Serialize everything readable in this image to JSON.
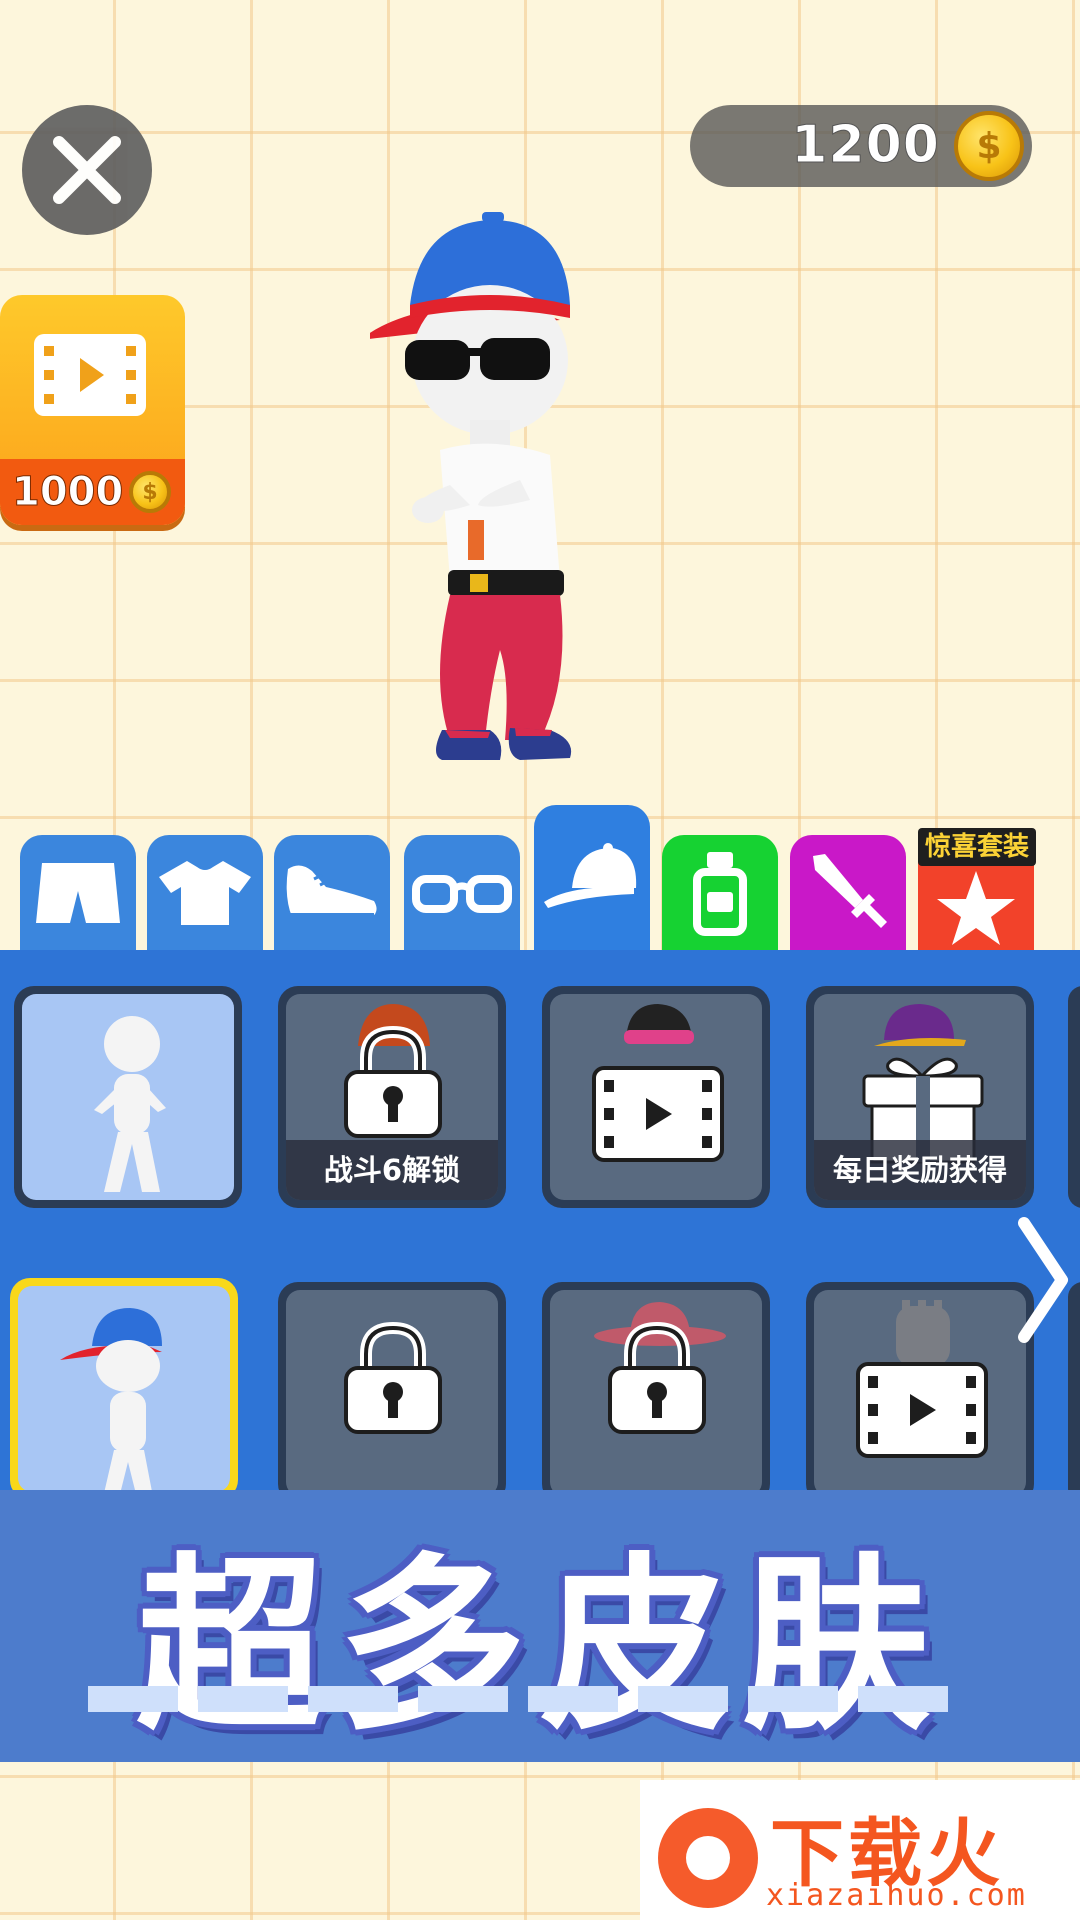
{
  "hud": {
    "coins": "1200",
    "coin_symbol": "$",
    "close_icon": "close-x-icon",
    "video_reward": {
      "icon": "video-icon",
      "amount": "1000",
      "coin_symbol": "$"
    }
  },
  "character": {
    "description_icon": "stickman-with-blue-cap-sunglasses-red-pants"
  },
  "tabs": [
    {
      "name": "pants",
      "icon": "shorts-icon",
      "active": false
    },
    {
      "name": "shirt",
      "icon": "tshirt-icon",
      "active": false
    },
    {
      "name": "shoes",
      "icon": "sneaker-icon",
      "active": false
    },
    {
      "name": "glasses",
      "icon": "glasses-icon",
      "active": false
    },
    {
      "name": "hat",
      "icon": "cap-icon",
      "active": true
    },
    {
      "name": "potion",
      "icon": "bottle-icon",
      "active": false
    },
    {
      "name": "weapon",
      "icon": "sword-icon",
      "active": false
    },
    {
      "name": "surprise-set",
      "icon": "star-icon",
      "active": false,
      "label": "惊喜套装"
    }
  ],
  "items": [
    {
      "state": "owned",
      "caption": ""
    },
    {
      "state": "locked",
      "caption": "战斗6解锁"
    },
    {
      "state": "video",
      "caption": ""
    },
    {
      "state": "gift",
      "caption": "每日奖励获得"
    },
    {
      "state": "selected",
      "caption": ""
    },
    {
      "state": "locked",
      "caption": ""
    },
    {
      "state": "locked",
      "caption": ""
    },
    {
      "state": "video",
      "caption": ""
    }
  ],
  "banner": {
    "title": "超多皮肤"
  },
  "watermark": {
    "title": "下载火",
    "url": "xiazaihuo.com"
  },
  "colors": {
    "panel": "#2e74d6",
    "tab": "#3b86dd",
    "banner": "#4d7ccc",
    "coin": "#f8c318"
  }
}
